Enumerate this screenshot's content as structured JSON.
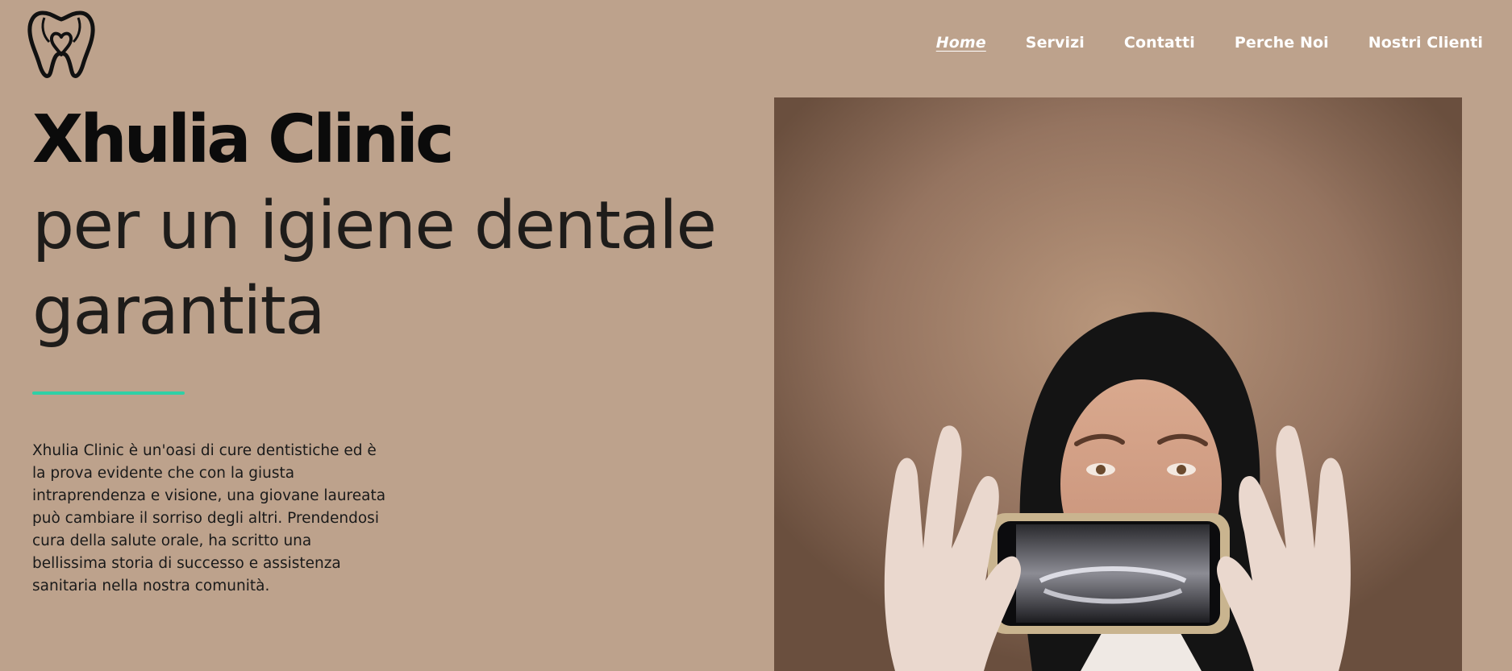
{
  "nav": {
    "items": [
      {
        "label": "Home",
        "active": true
      },
      {
        "label": "Servizi",
        "active": false
      },
      {
        "label": "Contatti",
        "active": false
      },
      {
        "label": "Perche Noi",
        "active": false
      },
      {
        "label": "Nostri Clienti",
        "active": false
      }
    ]
  },
  "hero": {
    "title": "Xhulia Clinic",
    "subtitle_line1": "per un igiene dentale",
    "subtitle_line2": "garantita",
    "intro": "Xhulia Clinic è un'oasi di cure dentistiche ed è la prova evidente che con la giusta intraprendenza e visione, una giovane laureata può cambiare il sorriso degli altri. Prendendosi cura della salute orale, ha scritto una bellissima storia di successo e assistenza sanitaria nella nostra comunità."
  },
  "colors": {
    "background": "#BDA28C",
    "accent": "#2FD0A6",
    "nav_text": "#FFFFFF"
  },
  "icons": {
    "logo": "tooth-heart-icon"
  }
}
